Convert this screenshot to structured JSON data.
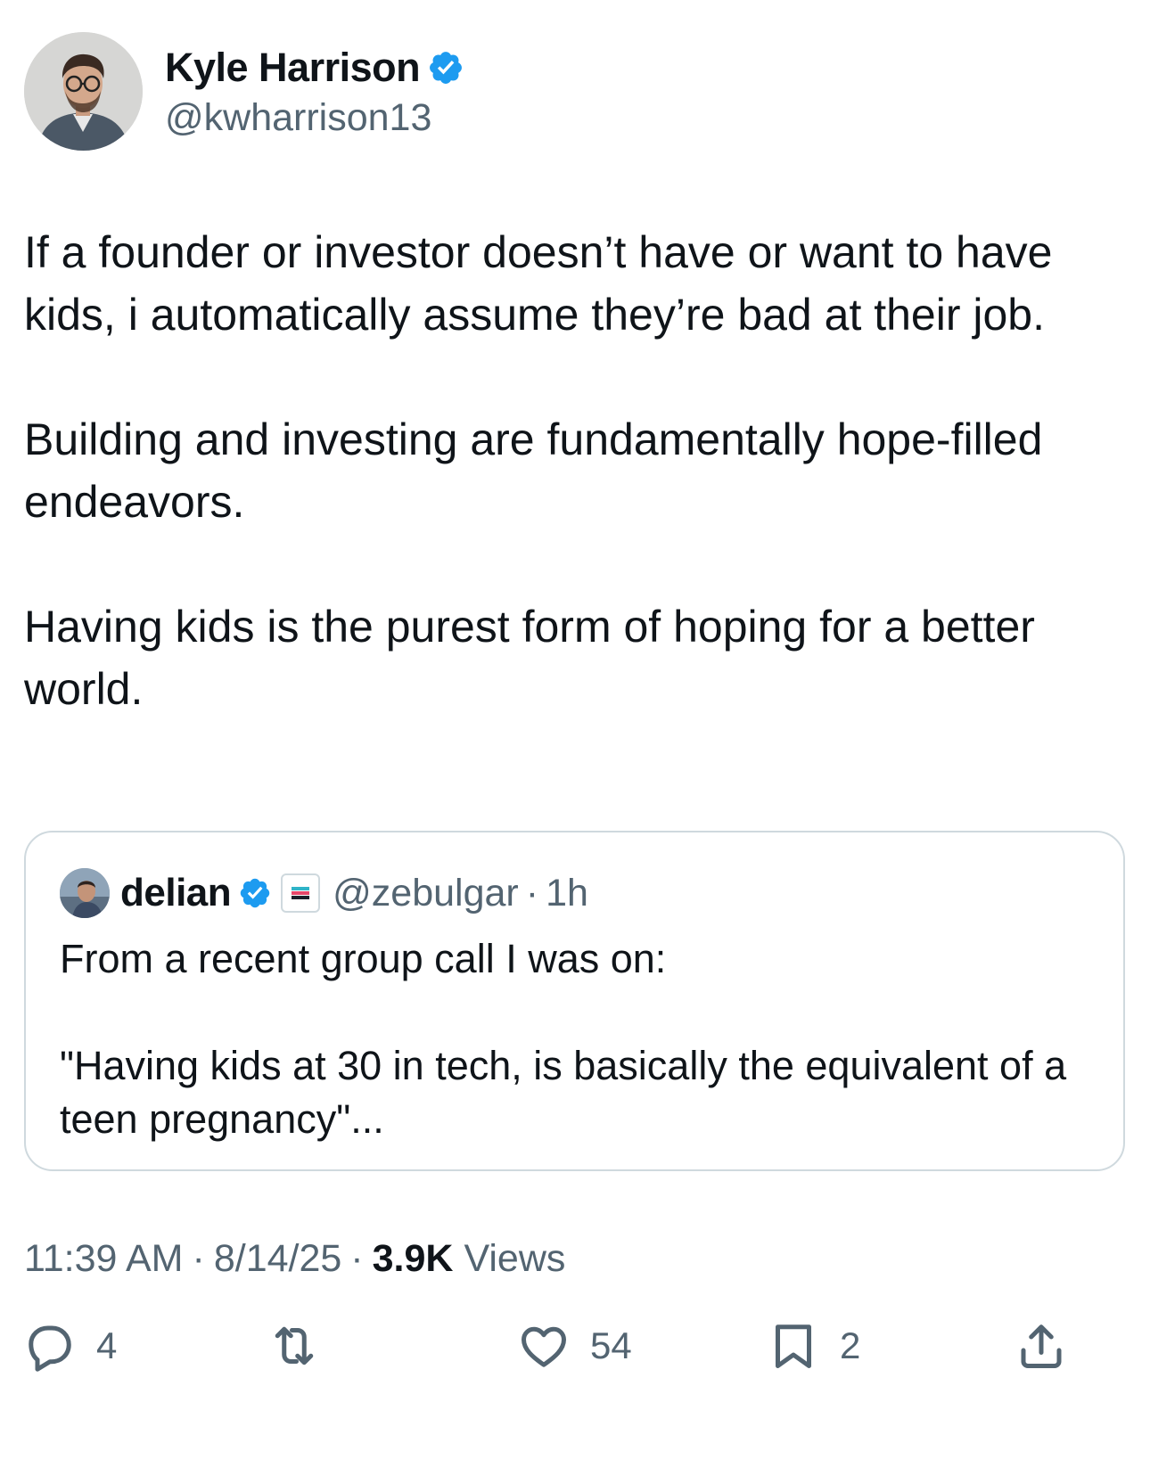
{
  "author": {
    "name": "Kyle Harrison",
    "handle": "@kwharrison13",
    "verified": true
  },
  "tweet": {
    "paragraphs": [
      "If a founder or investor doesn’t have or want to have kids, i automatically assume they’re bad at their job.",
      "Building and investing are fundamentally hope-filled endeavors.",
      "Having kids is the purest form of hoping for a better world."
    ]
  },
  "quoted_tweet": {
    "name": "delian",
    "handle": "@zebulgar",
    "separator": "·",
    "time": "1h",
    "verified": true,
    "paragraphs": [
      "From a recent group call I was on:",
      "\"Having kids at 30 in tech, is basically the equivalent of a teen pregnancy\"..."
    ]
  },
  "meta": {
    "time": "11:39 AM",
    "separator": "·",
    "date": "8/14/25",
    "views_count": "3.9K",
    "views_label": "Views"
  },
  "actions": {
    "replies": "4",
    "retweets": "",
    "likes": "54",
    "bookmarks": "2"
  },
  "colors": {
    "text": "#0f1419",
    "secondary": "#536471",
    "verified_blue": "#1d9bf0",
    "border": "#cfd9de"
  },
  "icons": [
    "verified-badge-icon",
    "reply-icon",
    "retweet-icon",
    "like-icon",
    "bookmark-icon",
    "share-icon"
  ]
}
